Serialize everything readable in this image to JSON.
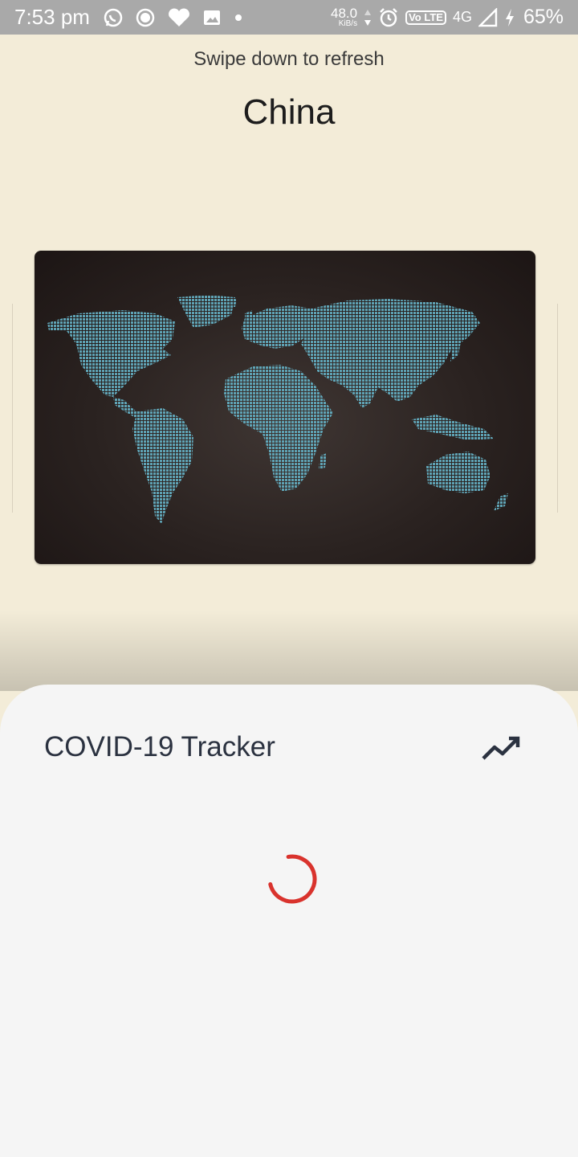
{
  "status_bar": {
    "time": "7:53 pm",
    "net_speed_value": "48.0",
    "net_speed_unit": "KiB/s",
    "volte": "Vo LTE",
    "network": "4G",
    "battery": "65%",
    "icons_left": [
      "whatsapp-icon",
      "record-icon",
      "heart-icon",
      "image-icon",
      "dot-icon"
    ],
    "icons_right": [
      "data-arrows-icon",
      "alarm-icon",
      "signal-icon",
      "charging-icon"
    ]
  },
  "header": {
    "hint": "Swipe down to refresh",
    "country": "China"
  },
  "map": {
    "icon": "world-map-image",
    "background": "#2a2220",
    "dot_color": "#5fa3b5"
  },
  "sheet": {
    "title": "COVID-19 Tracker",
    "action_icon": "trending-up-icon",
    "loading": true,
    "spinner_color": "#d9332d"
  },
  "colors": {
    "page_background": "#f3ecd8",
    "sheet_background": "#f5f5f5",
    "status_bar": "#a9a9a9",
    "title_text": "#2b3240"
  }
}
